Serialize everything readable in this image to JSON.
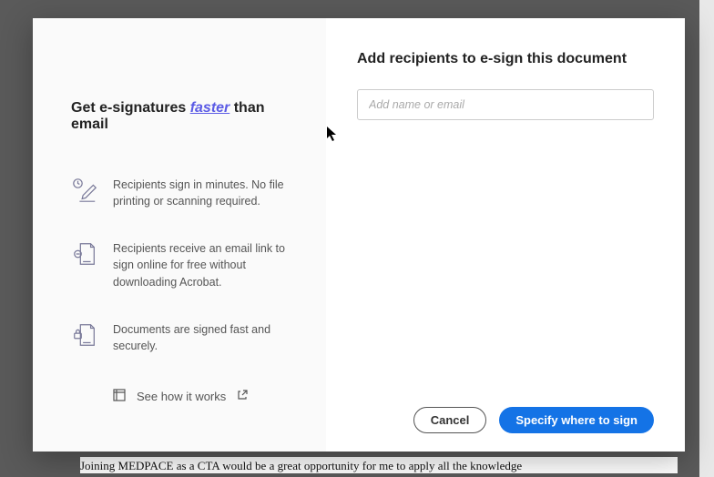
{
  "backgroundDoc": {
    "visibleLine": "Joining MEDPACE as a CTA would be a great opportunity for me to apply all the knowledge"
  },
  "dialog": {
    "left": {
      "headline_pre": "Get e-signatures ",
      "headline_em": "faster",
      "headline_post": " than email",
      "features": [
        {
          "text": "Recipients sign in minutes. No file printing or scanning required."
        },
        {
          "text": "Recipients receive an email link to sign online for free without downloading Acrobat."
        },
        {
          "text": "Documents are signed fast and securely."
        }
      ],
      "seeHow": "See how it works"
    },
    "right": {
      "title": "Add recipients to e-sign this document",
      "inputPlaceholder": "Add name or email",
      "cancel": "Cancel",
      "primary": "Specify where to sign"
    }
  }
}
